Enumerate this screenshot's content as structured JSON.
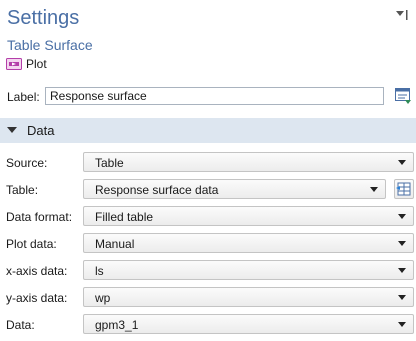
{
  "header": {
    "title": "Settings",
    "subtitle": "Table Surface",
    "plot_button": "Plot"
  },
  "label_field": {
    "caption": "Label:",
    "value": "Response surface"
  },
  "section": {
    "title": "Data"
  },
  "fields": {
    "source": {
      "label": "Source:",
      "value": "Table"
    },
    "table": {
      "label": "Table:",
      "value": "Response surface data"
    },
    "data_format": {
      "label": "Data format:",
      "value": "Filled table"
    },
    "plot_data": {
      "label": "Plot data:",
      "value": "Manual"
    },
    "x_axis_data": {
      "label": "x-axis data:",
      "value": "ls"
    },
    "y_axis_data": {
      "label": "y-axis data:",
      "value": "wp"
    },
    "data": {
      "label": "Data:",
      "value": "gpm3_1"
    }
  },
  "icons": {
    "plot": "plot-icon",
    "label_action": "label-edit-icon",
    "table_action": "table-goto-icon",
    "header_menu": "panel-menu-icon"
  },
  "colors": {
    "title": "#4a6fa5",
    "section_bg": "#dde6f0",
    "plot_icon": "#b43ea9"
  }
}
